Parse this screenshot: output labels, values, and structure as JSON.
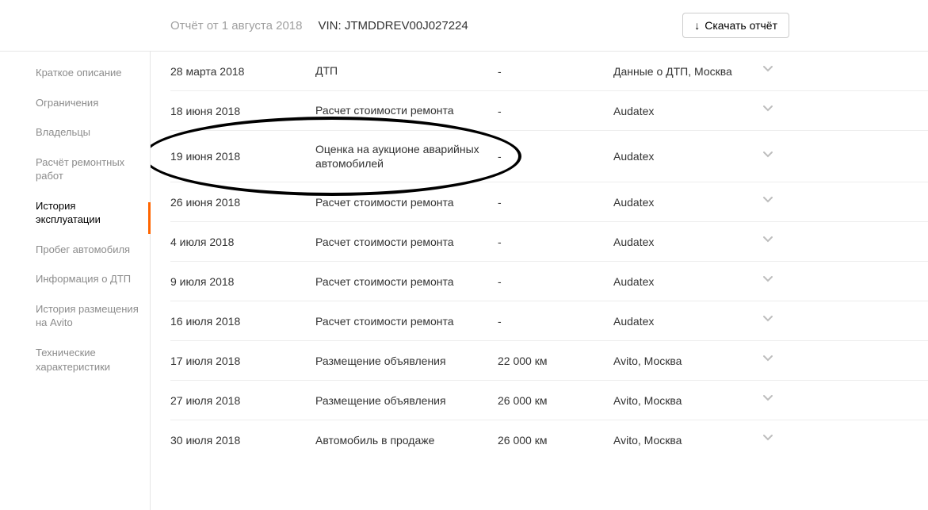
{
  "header": {
    "report_date": "Отчёт от 1 августа 2018",
    "vin_label": "VIN: JTMDDREV00J027224",
    "download_label": "Скачать отчёт",
    "download_icon": "↓"
  },
  "sidebar": {
    "items": [
      {
        "label": "Краткое описание",
        "active": false
      },
      {
        "label": "Ограничения",
        "active": false
      },
      {
        "label": "Владельцы",
        "active": false
      },
      {
        "label": "Расчёт ремонтных работ",
        "active": false
      },
      {
        "label": "История эксплуатации",
        "active": true
      },
      {
        "label": "Пробег автомобиля",
        "active": false
      },
      {
        "label": "Информация о ДТП",
        "active": false
      },
      {
        "label": "История размещения на Avito",
        "active": false
      },
      {
        "label": "Технические характеристики",
        "active": false
      }
    ]
  },
  "table": {
    "rows": [
      {
        "date": "28 марта 2018",
        "event": "ДТП",
        "mileage": "-",
        "source": "Данные о ДТП, Москва"
      },
      {
        "date": "18 июня 2018",
        "event": "Расчет стоимости ремонта",
        "mileage": "-",
        "source": "Audatex"
      },
      {
        "date": "19 июня 2018",
        "event": "Оценка на аукционе аварийных автомобилей",
        "mileage": "-",
        "source": "Audatex"
      },
      {
        "date": "26 июня 2018",
        "event": "Расчет стоимости ремонта",
        "mileage": "-",
        "source": "Audatex"
      },
      {
        "date": "4 июля 2018",
        "event": "Расчет стоимости ремонта",
        "mileage": "-",
        "source": "Audatex"
      },
      {
        "date": "9 июля 2018",
        "event": "Расчет стоимости ремонта",
        "mileage": "-",
        "source": "Audatex"
      },
      {
        "date": "16 июля 2018",
        "event": "Расчет стоимости ремонта",
        "mileage": "-",
        "source": "Audatex"
      },
      {
        "date": "17 июля 2018",
        "event": "Размещение объявления",
        "mileage": "22 000 км",
        "source": "Avito, Москва"
      },
      {
        "date": "27 июля 2018",
        "event": "Размещение объявления",
        "mileage": "26 000 км",
        "source": "Avito, Москва"
      },
      {
        "date": "30 июля 2018",
        "event": "Автомобиль в продаже",
        "mileage": "26 000 км",
        "source": "Avito, Москва"
      }
    ]
  },
  "annotation": {
    "circled_row_index": 2
  }
}
